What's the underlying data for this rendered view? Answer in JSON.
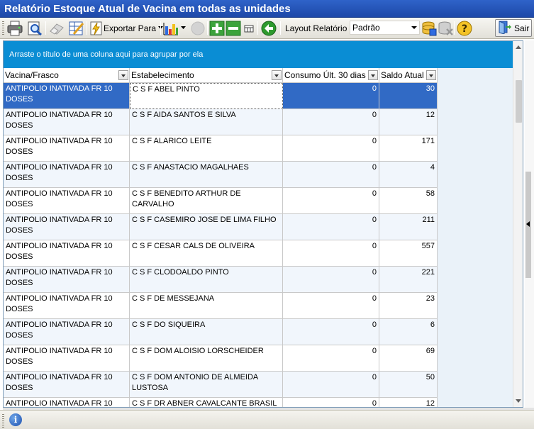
{
  "window": {
    "title": "Relatório Estoque Atual de Vacina em todas as unidades"
  },
  "toolbar": {
    "print_icon": "printer-icon",
    "preview_icon": "print-preview-icon",
    "eraser_icon": "eraser-icon",
    "edit_icon": "edit-report-icon",
    "export_label": "Exportar Para",
    "chart_icon": "bar-chart-icon",
    "add_icon": "plus-icon",
    "remove_icon": "minus-icon",
    "refresh_icon": "refresh-icon",
    "layout_label": "Layout Relatório",
    "layout_value": "Padrão",
    "help_icon": "help-icon",
    "exit_label": "Sair"
  },
  "grid": {
    "group_hint": "Arraste o título de uma coluna aqui para agrupar por ela",
    "columns": [
      "Vacina/Frasco",
      "Estabelecimento",
      "Consumo Últ. 30 dias",
      "Saldo Atual"
    ],
    "rows": [
      {
        "vacina": "ANTIPOLIO INATIVADA FR 10 DOSES",
        "estabelecimento": "C S F ABEL PINTO",
        "consumo": "0",
        "saldo": "30"
      },
      {
        "vacina": "ANTIPOLIO INATIVADA FR 10 DOSES",
        "estabelecimento": "C S F AIDA SANTOS E SILVA",
        "consumo": "0",
        "saldo": "12"
      },
      {
        "vacina": "ANTIPOLIO INATIVADA FR 10 DOSES",
        "estabelecimento": "C S F ALARICO LEITE",
        "consumo": "0",
        "saldo": "171"
      },
      {
        "vacina": "ANTIPOLIO INATIVADA FR 10 DOSES",
        "estabelecimento": "C S F ANASTACIO MAGALHAES",
        "consumo": "0",
        "saldo": "4"
      },
      {
        "vacina": "ANTIPOLIO INATIVADA FR 10 DOSES",
        "estabelecimento": "C S F BENEDITO ARTHUR DE CARVALHO",
        "consumo": "0",
        "saldo": "58"
      },
      {
        "vacina": "ANTIPOLIO INATIVADA FR 10 DOSES",
        "estabelecimento": "C S F CASEMIRO JOSE DE LIMA FILHO",
        "consumo": "0",
        "saldo": "211"
      },
      {
        "vacina": "ANTIPOLIO INATIVADA FR 10 DOSES",
        "estabelecimento": "C S F CESAR CALS DE OLIVEIRA",
        "consumo": "0",
        "saldo": "557"
      },
      {
        "vacina": "ANTIPOLIO INATIVADA FR 10 DOSES",
        "estabelecimento": "C S F CLODOALDO PINTO",
        "consumo": "0",
        "saldo": "221"
      },
      {
        "vacina": "ANTIPOLIO INATIVADA FR 10 DOSES",
        "estabelecimento": "C S F DE MESSEJANA",
        "consumo": "0",
        "saldo": "23"
      },
      {
        "vacina": "ANTIPOLIO INATIVADA FR 10 DOSES",
        "estabelecimento": "C S F DO SIQUEIRA",
        "consumo": "0",
        "saldo": "6"
      },
      {
        "vacina": "ANTIPOLIO INATIVADA FR 10 DOSES",
        "estabelecimento": "C S F DOM ALOISIO LORSCHEIDER",
        "consumo": "0",
        "saldo": "69"
      },
      {
        "vacina": "ANTIPOLIO INATIVADA FR 10 DOSES",
        "estabelecimento": "C S F DOM ANTONIO DE ALMEIDA LUSTOSA",
        "consumo": "0",
        "saldo": "50"
      },
      {
        "vacina": "ANTIPOLIO INATIVADA FR 10",
        "estabelecimento": "C S F DR ABNER CAVALCANTE BRASIL",
        "consumo": "0",
        "saldo": "12"
      }
    ]
  },
  "colors": {
    "title_bar": "#1d48a8",
    "group_bar": "#0a8dd4",
    "selection": "#316ac5"
  },
  "statusbar": {
    "info_icon": "info-icon"
  }
}
